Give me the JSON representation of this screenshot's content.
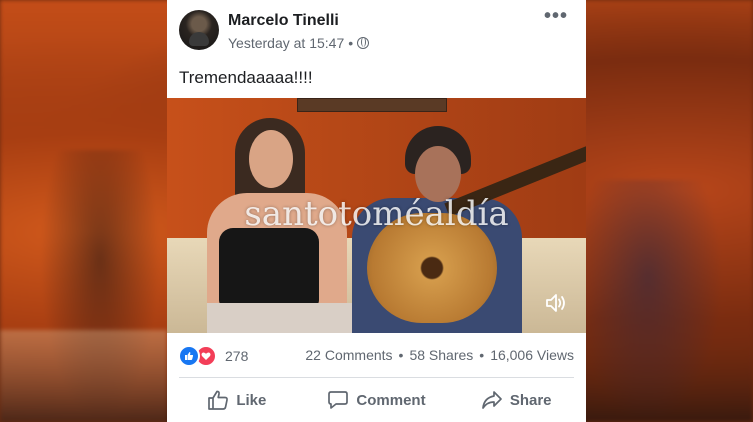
{
  "post": {
    "author": "Marcelo Tinelli",
    "timestamp": "Yesterday at 15:47",
    "separator": "•",
    "more_glyph": "•••",
    "text": "Tremendaaaaa!!!!"
  },
  "video": {
    "watermark": "santotoméaldía"
  },
  "stats": {
    "reaction_count": "278",
    "comments": "22 Comments",
    "shares": "58 Shares",
    "views": "16,006 Views",
    "dot": "•"
  },
  "actions": {
    "like": "Like",
    "comment": "Comment",
    "share": "Share"
  },
  "icons": {
    "privacy": "globe-icon",
    "reactions": [
      "like-reaction-icon",
      "love-reaction-icon"
    ],
    "volume": "volume-icon"
  },
  "colors": {
    "like_blue": "#1877f2",
    "love_red": "#f33e58",
    "text": "#1c1e21",
    "secondary": "#606770"
  }
}
